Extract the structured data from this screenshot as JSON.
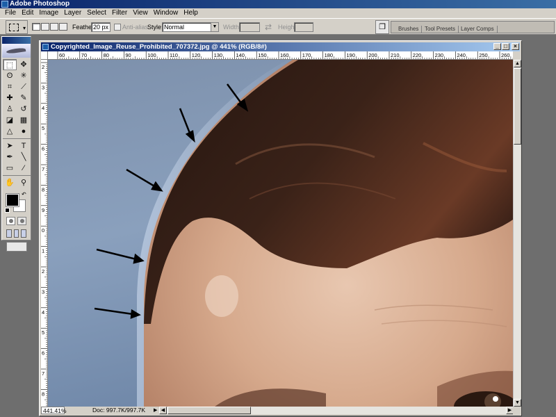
{
  "app": {
    "title": "Adobe Photoshop"
  },
  "menu": {
    "items": [
      "File",
      "Edit",
      "Image",
      "Layer",
      "Select",
      "Filter",
      "View",
      "Window",
      "Help"
    ]
  },
  "options": {
    "feather_label": "Feather:",
    "feather_value": "20 px",
    "antialias_label": "Anti-alias",
    "style_label": "Style:",
    "style_value": "Normal",
    "width_label": "Width:",
    "height_label": "Height:",
    "palette_tabs": [
      "Brushes",
      "Tool Presets",
      "Layer Comps"
    ]
  },
  "document": {
    "title": "Copyrighted_Image_Reuse_Prohibited_707372.jpg @ 441% (RGB/8#)",
    "zoom": "441.41%",
    "doc_info": "Doc: 997.7K/997.7K",
    "ruler_h_labels": [
      "60",
      "70",
      "80",
      "90",
      "100",
      "110",
      "120",
      "130",
      "140",
      "150",
      "160",
      "170",
      "180",
      "190",
      "200",
      "210",
      "220",
      "230",
      "240",
      "250",
      "260"
    ],
    "ruler_v_labels": [
      "2",
      "3",
      "4",
      "5",
      "6",
      "7",
      "8",
      "9",
      "0",
      "1",
      "2",
      "3",
      "4",
      "5",
      "6",
      "7",
      "8"
    ]
  },
  "toolbox": {
    "tools": [
      {
        "icon": "marquee-tool-icon",
        "glyph": "⬚"
      },
      {
        "icon": "move-tool-icon",
        "glyph": "✥"
      },
      {
        "icon": "lasso-tool-icon",
        "glyph": "ʘ"
      },
      {
        "icon": "magic-wand-tool-icon",
        "glyph": "✳"
      },
      {
        "icon": "crop-tool-icon",
        "glyph": "⌗"
      },
      {
        "icon": "slice-tool-icon",
        "glyph": "⟋"
      },
      {
        "icon": "healing-brush-tool-icon",
        "glyph": "✚"
      },
      {
        "icon": "brush-tool-icon",
        "glyph": "✎"
      },
      {
        "icon": "clone-stamp-tool-icon",
        "glyph": "♙"
      },
      {
        "icon": "history-brush-tool-icon",
        "glyph": "↺"
      },
      {
        "icon": "eraser-tool-icon",
        "glyph": "◪"
      },
      {
        "icon": "gradient-tool-icon",
        "glyph": "▦"
      },
      {
        "icon": "blur-tool-icon",
        "glyph": "△"
      },
      {
        "icon": "dodge-tool-icon",
        "glyph": "●"
      },
      {
        "icon": "path-selection-tool-icon",
        "glyph": "➤"
      },
      {
        "icon": "type-tool-icon",
        "glyph": "T"
      },
      {
        "icon": "pen-tool-icon",
        "glyph": "✒"
      },
      {
        "icon": "line-tool-icon",
        "glyph": "╲"
      },
      {
        "icon": "notes-tool-icon",
        "glyph": "▭"
      },
      {
        "icon": "eyedropper-tool-icon",
        "glyph": "⁄"
      },
      {
        "icon": "hand-tool-icon",
        "glyph": "✋"
      },
      {
        "icon": "zoom-tool-icon",
        "glyph": "⚲"
      }
    ]
  },
  "colors": {
    "foreground": "#000000",
    "background": "#ffffff",
    "title_bar": "#0a246a",
    "chrome": "#d4d0c8"
  }
}
